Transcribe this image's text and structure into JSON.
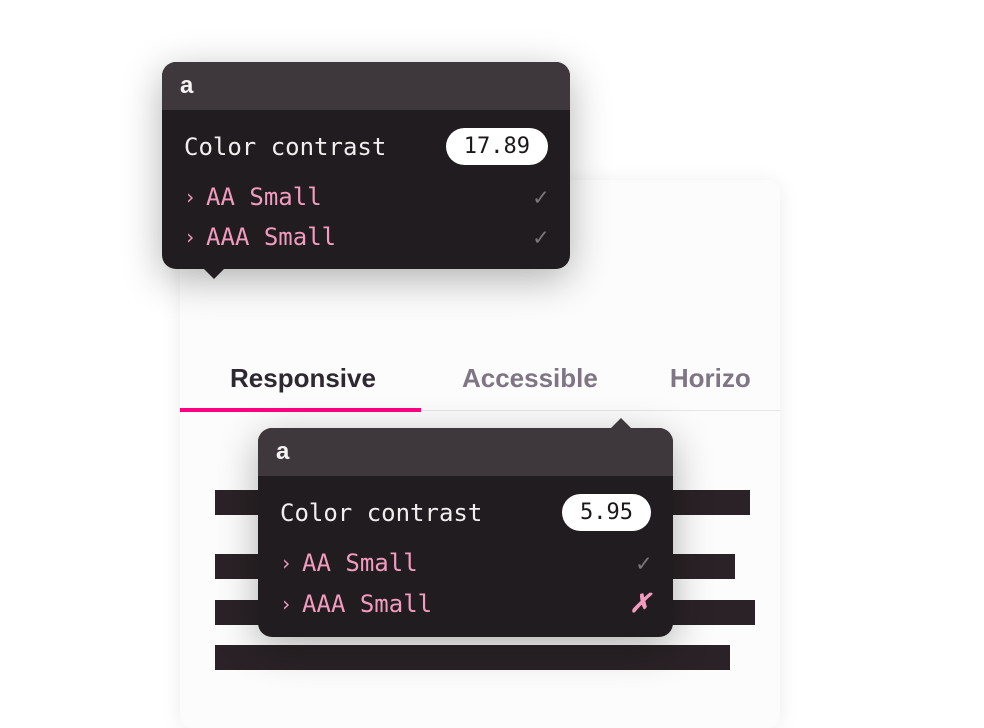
{
  "tabs": {
    "responsive": "Responsive",
    "accessible": "Accessible",
    "horizontal": "Horizo"
  },
  "tooltip1": {
    "header_glyph": "a",
    "contrast_label": "Color contrast",
    "contrast_value": "17.89",
    "checks": [
      {
        "label": "AA Small",
        "pass": true
      },
      {
        "label": "AAA Small",
        "pass": true
      }
    ]
  },
  "tooltip2": {
    "header_glyph": "a",
    "contrast_label": "Color contrast",
    "contrast_value": "5.95",
    "checks": [
      {
        "label": "AA Small",
        "pass": true
      },
      {
        "label": "AAA Small",
        "pass": false
      }
    ]
  },
  "colors": {
    "accent": "#ff0080",
    "pink_text": "#f19bbf",
    "tooltip_bg": "#211c1f",
    "tooltip_header_bg": "#3e383c"
  }
}
